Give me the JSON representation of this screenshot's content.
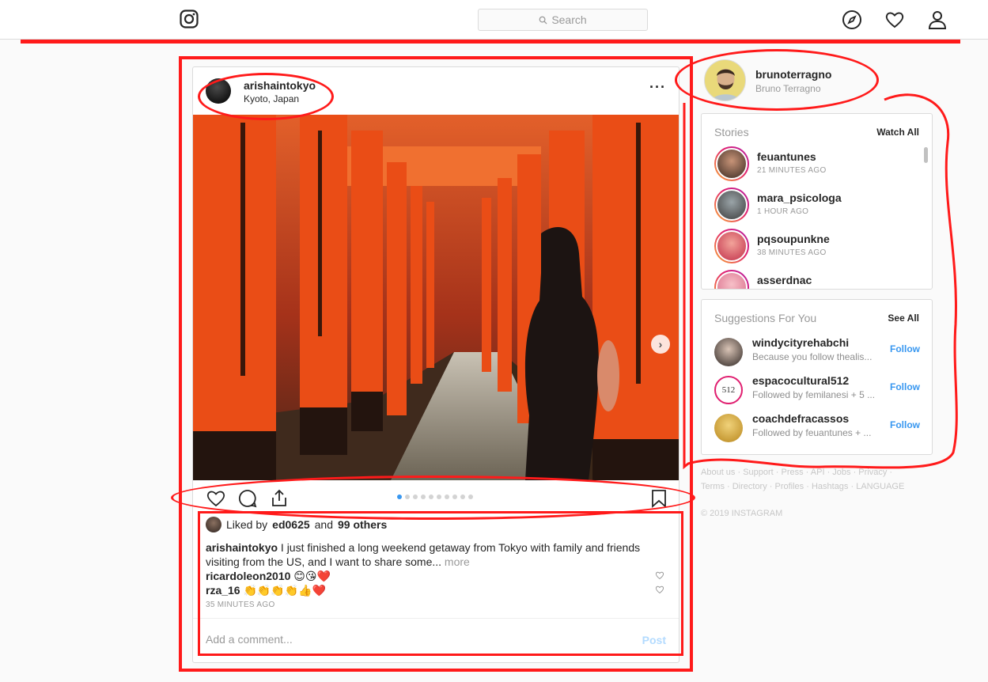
{
  "header": {
    "logo_icon": "instagram-logo-icon",
    "search_placeholder": "Search",
    "nav_icons": [
      "compass-icon",
      "heart-icon",
      "profile-icon"
    ]
  },
  "post": {
    "username": "arishaintokyo",
    "location": "Kyoto, Japan",
    "carousel": {
      "current": 1,
      "total": 10
    },
    "likes": {
      "user": "ed0625",
      "others": "99 others",
      "prefix": "Liked by",
      "joiner": "and"
    },
    "caption": {
      "username": "arishaintokyo",
      "text": "I just finished a long weekend getaway from Tokyo with family and friends visiting from the US, and I want to share some...",
      "more": "more"
    },
    "comments": [
      {
        "username": "ricardoleon2010",
        "text": "😊😘❤️"
      },
      {
        "username": "rza_16",
        "text": "👏👏👏👏👍❤️"
      }
    ],
    "time": "35 MINUTES AGO",
    "comment_placeholder": "Add a comment...",
    "post_button": "Post"
  },
  "profile": {
    "username": "brunoterragno",
    "name": "Bruno Terragno"
  },
  "stories": {
    "title": "Stories",
    "link": "Watch All",
    "items": [
      {
        "username": "feuantunes",
        "time": "21 MINUTES AGO"
      },
      {
        "username": "mara_psicologa",
        "time": "1 HOUR AGO"
      },
      {
        "username": "pqsoupunkne",
        "time": "38 MINUTES AGO"
      },
      {
        "username": "asserdnac",
        "time": ""
      }
    ]
  },
  "suggestions": {
    "title": "Suggestions For You",
    "link": "See All",
    "items": [
      {
        "username": "windycityrehabchi",
        "subtitle": "Because you follow thealis...",
        "action": "Follow"
      },
      {
        "username": "espacocultural512",
        "subtitle": "Followed by femilanesi + 5 ...",
        "action": "Follow"
      },
      {
        "username": "coachdefracassos",
        "subtitle": "Followed by feuantunes + ...",
        "action": "Follow"
      }
    ]
  },
  "footer": {
    "line1": "About us · Support · Press · API · Jobs · Privacy ·",
    "line2": "Terms · Directory · Profiles · Hashtags · LANGUAGE",
    "copyright": "© 2019 INSTAGRAM"
  },
  "colors": {
    "accent_blue": "#3897f0",
    "annotation_red": "#ff1a1a",
    "torii_orange": "#e2561f"
  }
}
